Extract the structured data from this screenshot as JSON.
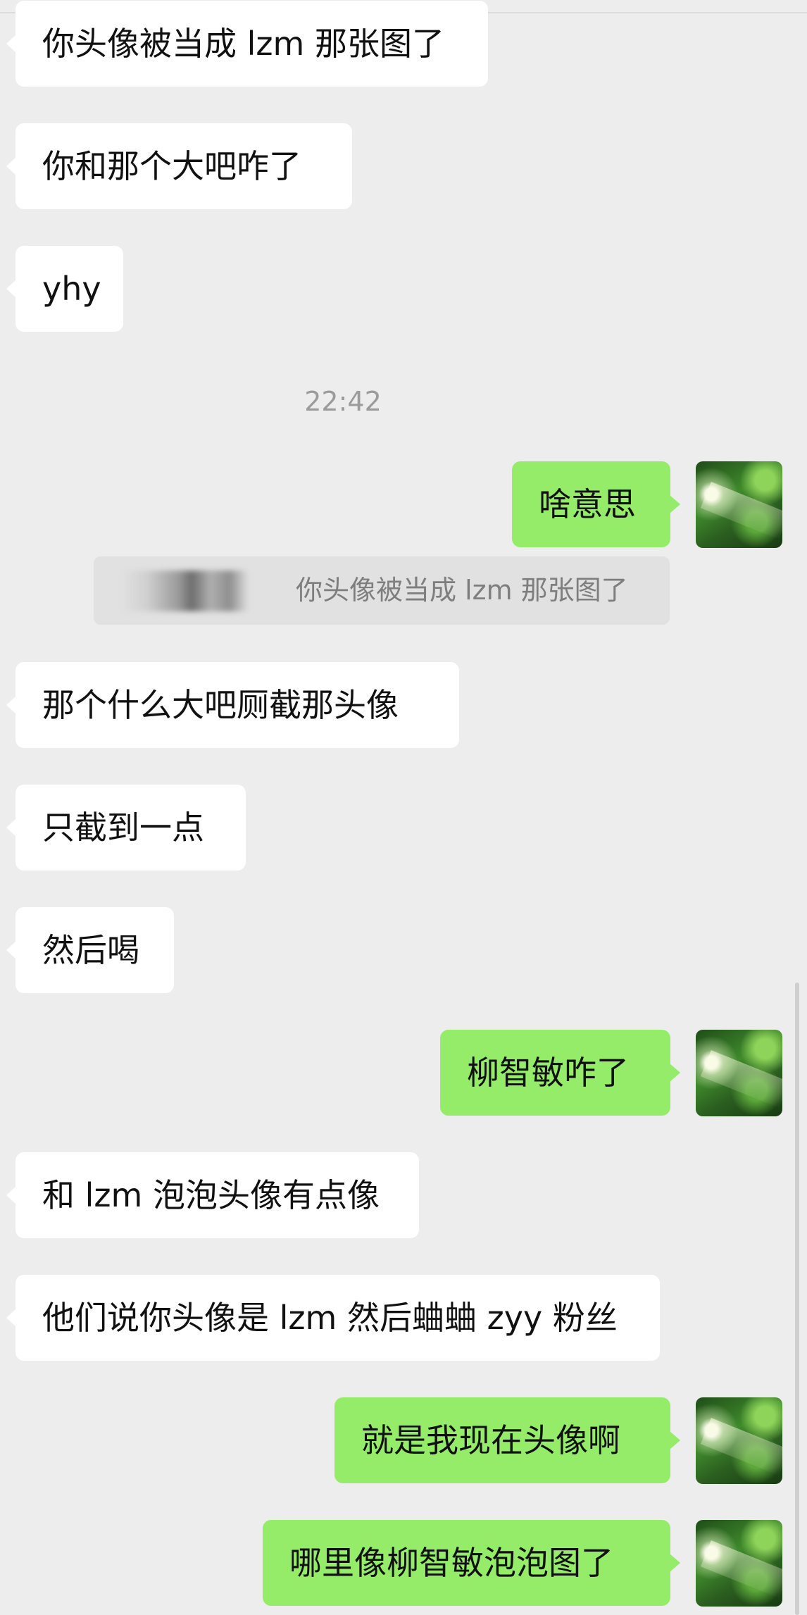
{
  "messages": {
    "m1": "你头像被当成 lzm 那张图了",
    "m2": "你和那个大吧咋了",
    "m3": "yhy",
    "m4": "啥意思",
    "m5": "那个什么大吧厕截那头像",
    "m6": "只截到一点",
    "m7": "然后喝",
    "m8": "柳智敏咋了",
    "m9": "和 lzm 泡泡头像有点像",
    "m10": "他们说你头像是 lzm 然后蛐蛐 zyy 粉丝",
    "m11": "就是我现在头像啊",
    "m12": "哪里像柳智敏泡泡图了"
  },
  "timestamp": "22:42",
  "quote": {
    "text": "你头像被当成 lzm 那张图了"
  },
  "colors": {
    "background": "#ededed",
    "incoming_bubble": "#ffffff",
    "outgoing_bubble": "#95ec69"
  },
  "icons": {
    "avatar": "user-avatar-green-forest",
    "quote_sender": "blurred-sender-name"
  }
}
